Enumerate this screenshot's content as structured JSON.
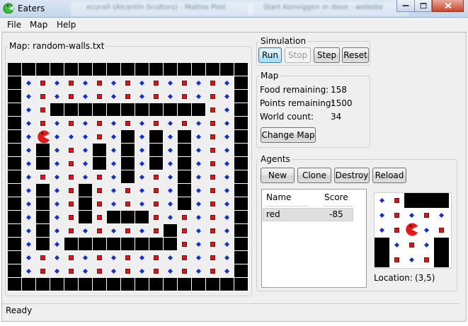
{
  "window": {
    "title": "Eaters",
    "ghost_tabs": [
      "ecurall (Alcantin Scultors) - Mattos Post",
      "Start Konviggen in dave - website"
    ]
  },
  "colors": {
    "wall": "#000000",
    "normal_food": "#1530c4",
    "bonus_food": "#d21a1a",
    "eater": "#e11b1b"
  },
  "menu": [
    "File",
    "Map",
    "Help"
  ],
  "map": {
    "legend": "Map: random-walls.txt",
    "grid": [
      "WWWWWWWWWWWWWWWWW",
      "WnbnbnbnbnbnbnbnW",
      "WnbnbnbnbnbnbnbnW",
      "WnbWWWWWWWWWWWbnW",
      "WnbnbnbnbnbnbnbnW",
      "WnEnnnbnWnWnWnbnW",
      "WnWnbnWnWnWnWnbnW",
      "WnWnbnWnWnWnWnbnW",
      "WnbnbnbnWnbnWnbnW",
      "WnWnbWbnbnbnWnbnW",
      "WnWnbWbnbnbnWnbnW",
      "WnWnbWbWWWbnbnbnW",
      "WnWnbnbnbnbWbnbnW",
      "WnWnWWWWWWWWbnbnW",
      "WnbnbnbnbnbnbnbnW",
      "WnbnbnbnbnbnbnbnW",
      "WWWWWWWWWWWWWWWWW"
    ]
  },
  "simulation": {
    "legend": "Simulation",
    "buttons": {
      "run": "Run",
      "stop": "Stop",
      "step": "Step",
      "reset": "Reset"
    }
  },
  "map_panel": {
    "legend": "Map",
    "food_label": "Food remaining:",
    "food_value": "158",
    "points_label": "Points remaining:",
    "points_value": "1500",
    "world_label": "World count:",
    "world_value": "34",
    "change_map": "Change Map"
  },
  "agents": {
    "legend": "Agents",
    "buttons": {
      "new": "New",
      "clone": "Clone",
      "destroy": "Destroy",
      "reload": "Reload"
    },
    "columns": [
      "Name",
      "Score"
    ],
    "rows": [
      {
        "name": "red",
        "score": "-85"
      }
    ],
    "location_label": "Location:",
    "location_value": "(3,5)",
    "view": [
      "nbWWW",
      "nbnbn",
      "nbEnb",
      "WnbnW",
      "WbnbW"
    ]
  },
  "status": "Ready"
}
